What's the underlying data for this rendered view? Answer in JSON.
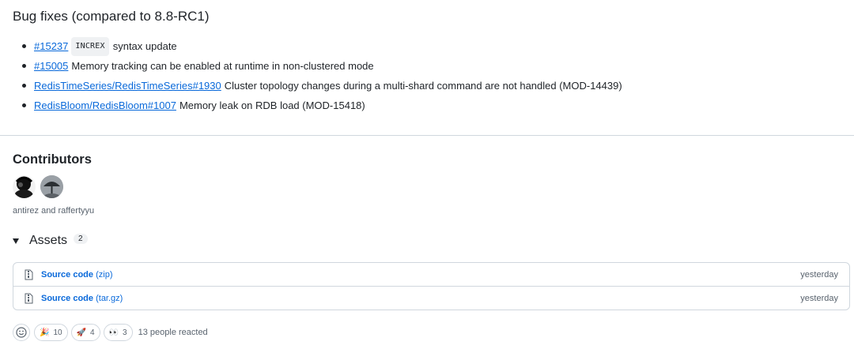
{
  "bug_fixes": {
    "title": "Bug fixes (compared to 8.8-RC1)",
    "items": [
      {
        "link": "#15237",
        "code": "INCREX",
        "text": "syntax update"
      },
      {
        "link": "#15005",
        "text": "Memory tracking can be enabled at runtime in non-clustered mode"
      },
      {
        "link": "RedisTimeSeries/RedisTimeSeries#1930",
        "text": "Cluster topology changes during a multi-shard command are not handled (MOD-14439)"
      },
      {
        "link": "RedisBloom/RedisBloom#1007",
        "text": "Memory leak on RDB load (MOD-15418)"
      }
    ]
  },
  "contributors": {
    "title": "Contributors",
    "names": "antirez and raffertyyu",
    "avatars": [
      "antirez",
      "raffertyyu"
    ]
  },
  "assets": {
    "title": "Assets",
    "count": "2",
    "items": [
      {
        "name": "Source code",
        "ext": "(zip)",
        "date": "yesterday",
        "icon": "file-zip-icon"
      },
      {
        "name": "Source code",
        "ext": "(tar.gz)",
        "date": "yesterday",
        "icon": "file-zip-icon"
      }
    ]
  },
  "reactions": {
    "add_icon": "smiley-icon",
    "items": [
      {
        "emoji": "🎉",
        "count": "10",
        "name": "hooray"
      },
      {
        "emoji": "🚀",
        "count": "4",
        "name": "rocket"
      },
      {
        "emoji": "👀",
        "count": "3",
        "name": "eyes"
      }
    ],
    "summary": "13 people reacted"
  },
  "colors": {
    "link": "#0969da",
    "border": "#d0d7de",
    "muted": "#59636e",
    "text": "#1f2328"
  }
}
